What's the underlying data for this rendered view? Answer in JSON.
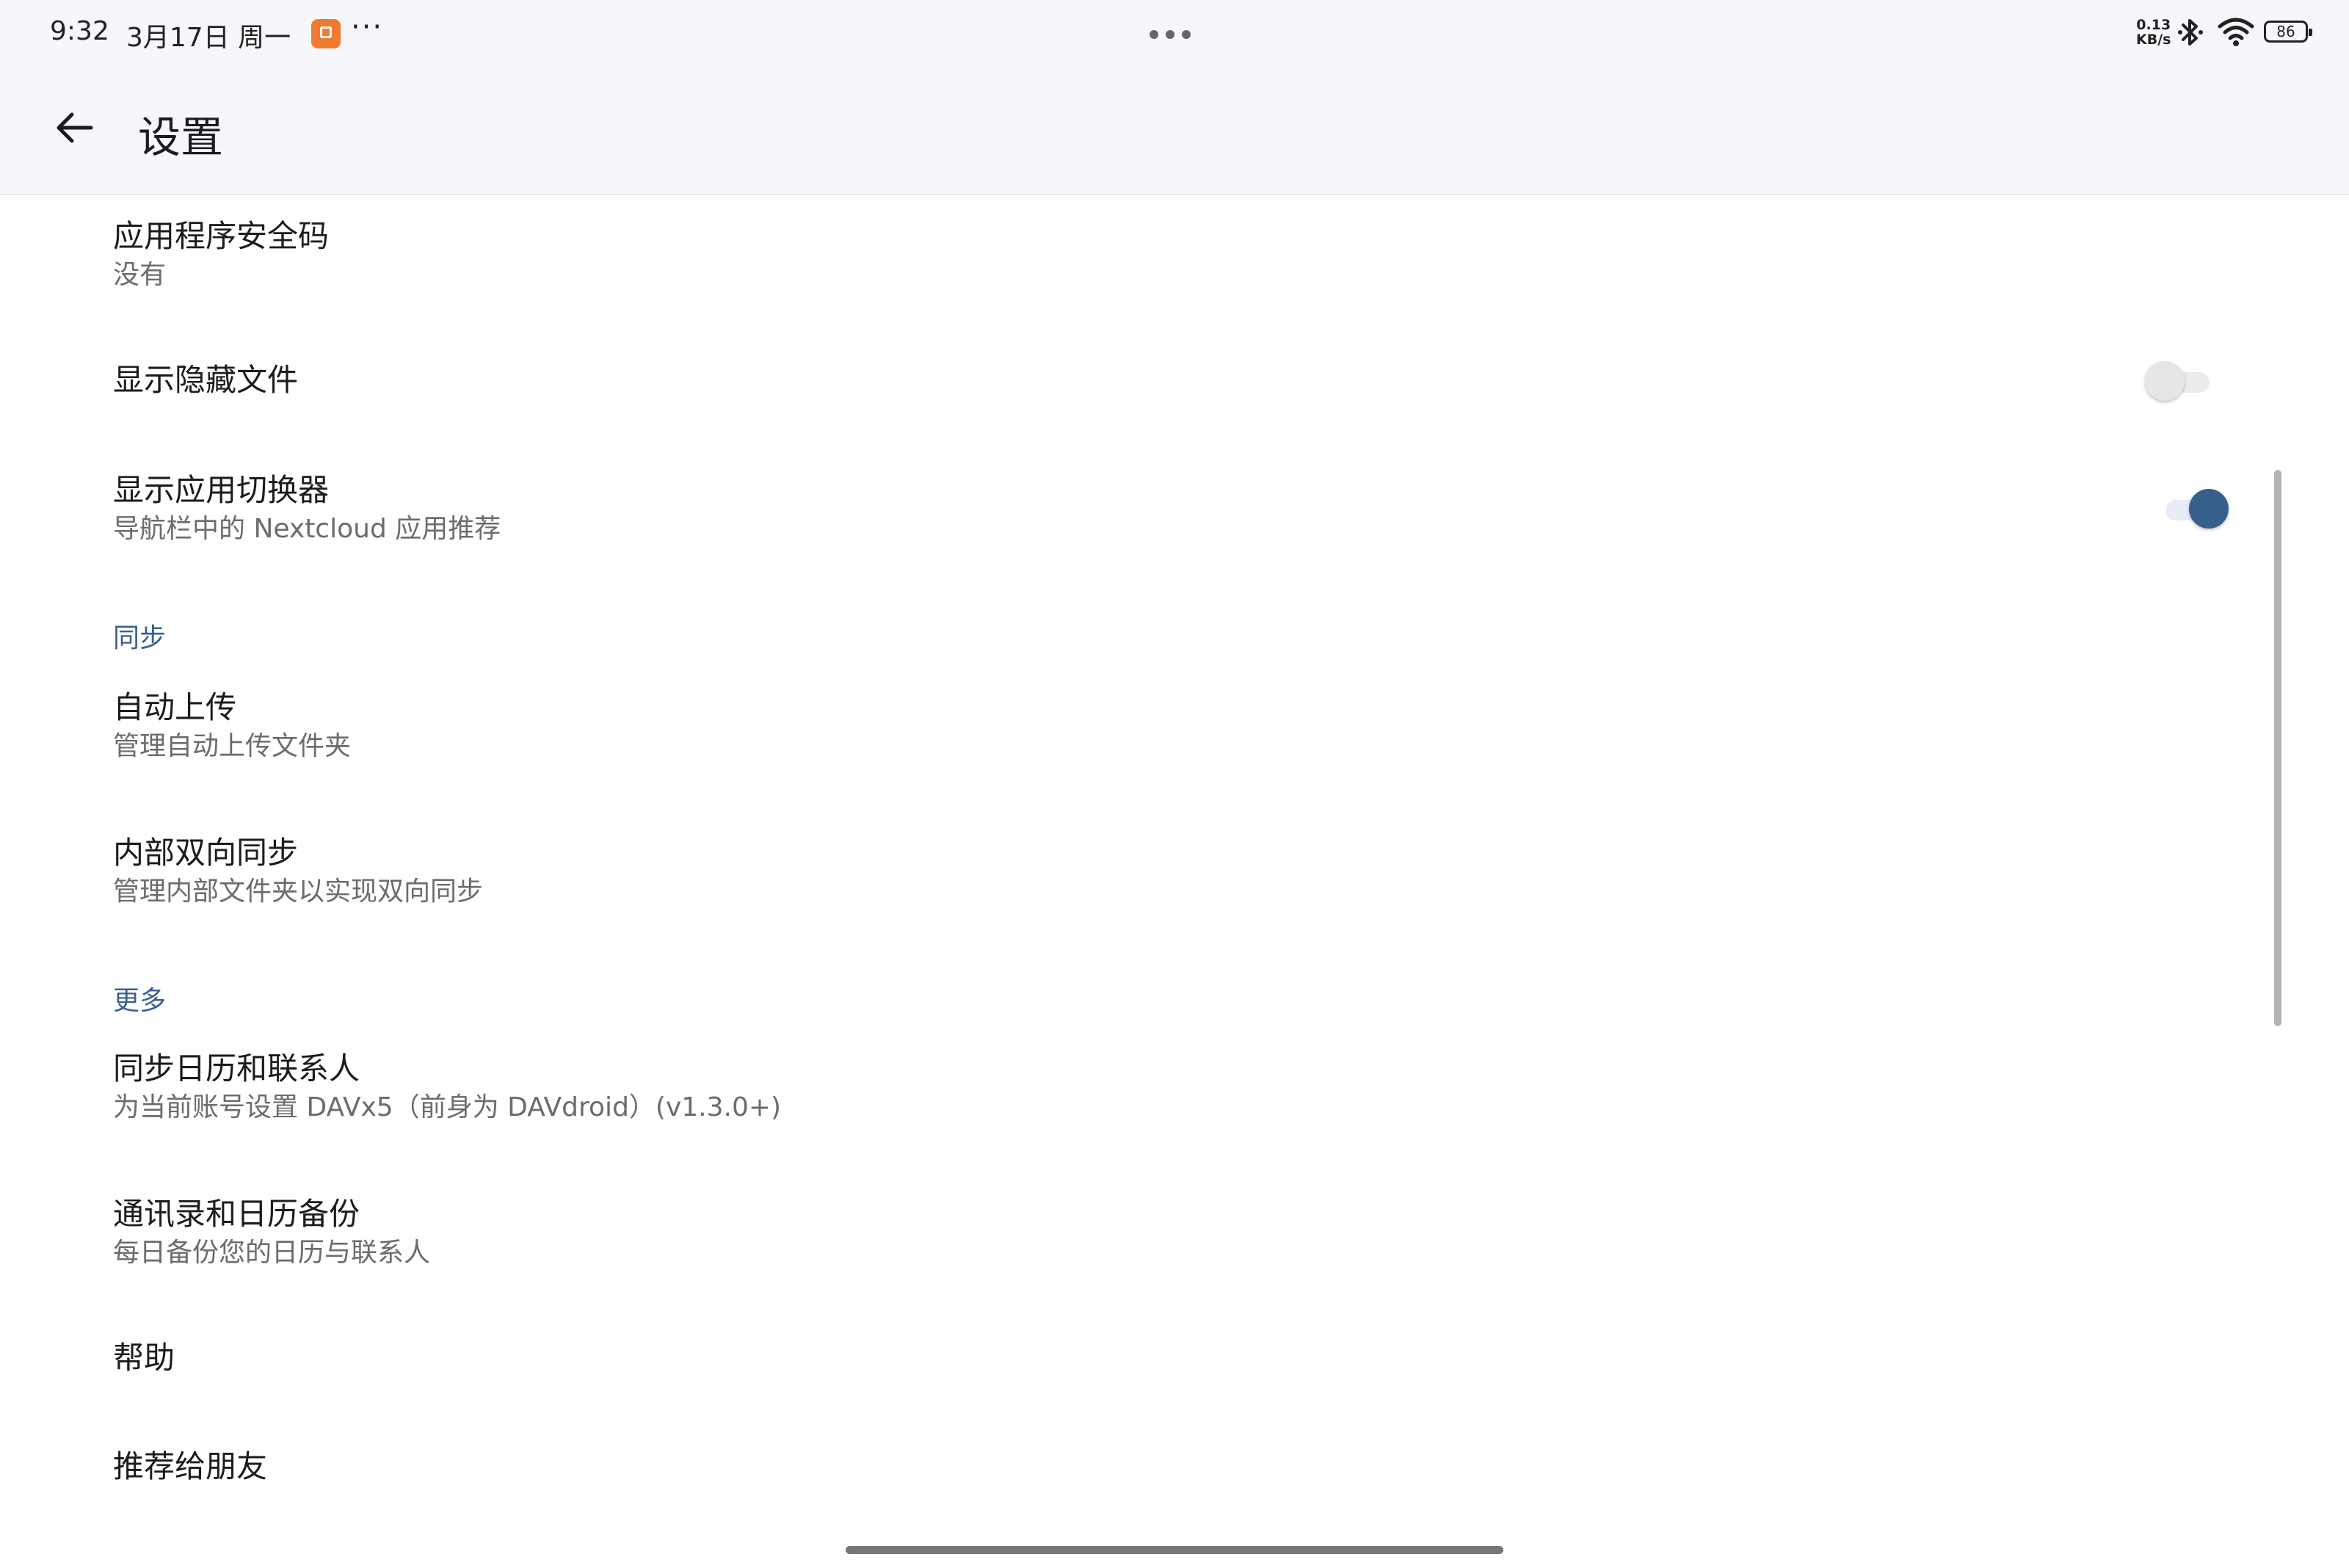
{
  "status_bar": {
    "time": "9:32",
    "date": "3月17日 周一",
    "more": "···",
    "net_speed_value": "0.13",
    "net_speed_unit": "KB/s",
    "battery": "86"
  },
  "app_bar": {
    "title": "设置"
  },
  "settings": {
    "app_passcode": {
      "title": "应用程序安全码",
      "summary": "没有"
    },
    "show_hidden": {
      "title": "显示隐藏文件",
      "checked": false
    },
    "app_switcher": {
      "title": "显示应用切换器",
      "summary": "导航栏中的 Nextcloud 应用推荐",
      "checked": true
    },
    "sync_header": "同步",
    "auto_upload": {
      "title": "自动上传",
      "summary": "管理自动上传文件夹"
    },
    "two_way_sync": {
      "title": "内部双向同步",
      "summary": "管理内部文件夹以实现双向同步"
    },
    "more_header": "更多",
    "calendar_contacts": {
      "title": "同步日历和联系人",
      "summary": "为当前账号设置 DAVx5（前身为 DAVdroid）(v1.3.0+)"
    },
    "backup": {
      "title": "通讯录和日历备份",
      "summary": "每日备份您的日历与联系人"
    },
    "help": {
      "title": "帮助"
    },
    "recommend": {
      "title": "推荐给朋友"
    }
  },
  "colors": {
    "accent": "#365f8c",
    "section_header": "#3a5f8f",
    "app_bar_bg": "#f6f7fb"
  }
}
